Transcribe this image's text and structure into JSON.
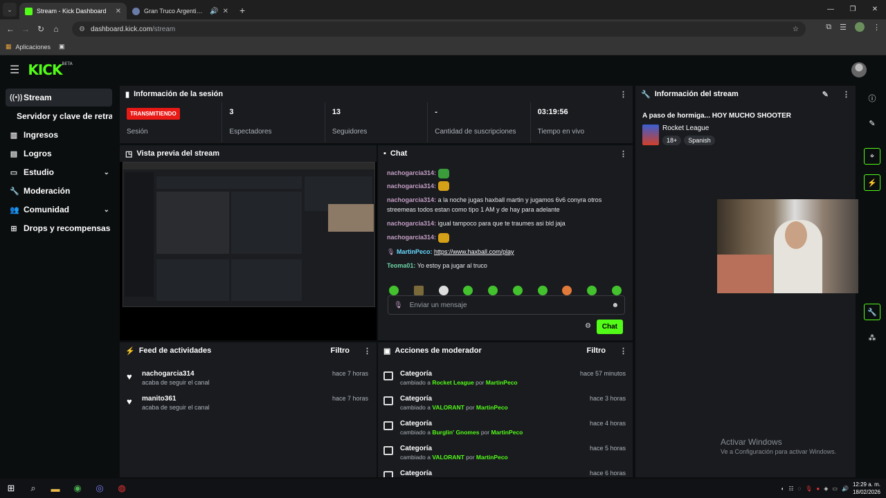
{
  "browser": {
    "tabs": [
      {
        "title": "Stream - Kick Dashboard",
        "active": true
      },
      {
        "title": "Gran Truco Argentino - Jue",
        "active": false
      }
    ],
    "url_host": "dashboard.kick.com",
    "url_path": "/stream",
    "bookmarks": {
      "apps_label": "Aplicaciones"
    }
  },
  "kick": {
    "logo": "KICK",
    "logo_beta": "BETA"
  },
  "sidebar": {
    "items": [
      {
        "label": "Stream",
        "icon": "broadcast-icon"
      },
      {
        "label": "Servidor y clave de retransmisión",
        "icon": ""
      },
      {
        "label": "Ingresos",
        "icon": "chart-icon"
      },
      {
        "label": "Logros",
        "icon": "trophy-icon"
      },
      {
        "label": "Estudio",
        "icon": "studio-icon"
      },
      {
        "label": "Moderación",
        "icon": "wrench-icon"
      },
      {
        "label": "Comunidad",
        "icon": "people-icon"
      },
      {
        "label": "Drops y recompensas",
        "icon": "gift-icon"
      }
    ]
  },
  "session": {
    "title": "Información de la sesión",
    "live_badge": "TRANSMITIENDO",
    "stats": [
      {
        "value": "",
        "label": "Sesión"
      },
      {
        "value": "3",
        "label": "Espectadores"
      },
      {
        "value": "13",
        "label": "Seguidores"
      },
      {
        "value": "-",
        "label": "Cantidad de suscripciones"
      },
      {
        "value": "03:19:56",
        "label": "Tiempo en vivo"
      }
    ]
  },
  "preview": {
    "title": "Vista previa del stream"
  },
  "chat": {
    "title": "Chat",
    "messages": [
      {
        "user": "nachogarcia314:",
        "text": ""
      },
      {
        "user": "nachogarcia314:",
        "text": ""
      },
      {
        "user": "nachogarcia314:",
        "text": "a la noche jugas haxball martin y jugamos 6v6 conyra otros streemeas todos estan como tipo 1 AM y de hay para adelante"
      },
      {
        "user": "nachogarcia314:",
        "text": "igual tampoco para que te traumes asi bld jaja"
      },
      {
        "user": "nachogarcia314:",
        "text": ""
      },
      {
        "user": "MartinPeco:",
        "text": "https://www.haxball.com/play"
      },
      {
        "user": "Teoma01:",
        "text": "Yo estoy pa jugar al truco"
      }
    ],
    "input_placeholder": "Enviar un mensaje",
    "send_label": "Chat"
  },
  "stream_info": {
    "title": "Información del stream",
    "stream_title": "A paso de hormiga... HOY MUCHO SHOOTER",
    "category": "Rocket League",
    "tags": [
      "18+",
      "Spanish"
    ]
  },
  "feed": {
    "title": "Feed de actividades",
    "filter_label": "Filtro",
    "items": [
      {
        "name": "nachogarcia314",
        "desc": "acaba de seguir el canal",
        "time": "hace 7 horas"
      },
      {
        "name": "manito361",
        "desc": "acaba de seguir el canal",
        "time": "hace 7 horas"
      }
    ]
  },
  "mod": {
    "title": "Acciones de moderador",
    "filter_label": "Filtro",
    "items": [
      {
        "name": "Categoría",
        "pre": "cambiado a ",
        "cat": "Rocket League",
        "mid": " por ",
        "by": "MartinPeco",
        "time": "hace 57 minutos"
      },
      {
        "name": "Categoría",
        "pre": "cambiado a ",
        "cat": "VALORANT",
        "mid": " por ",
        "by": "MartinPeco",
        "time": "hace 3 horas"
      },
      {
        "name": "Categoría",
        "pre": "cambiado a ",
        "cat": "Burglin' Gnomes",
        "mid": " por ",
        "by": "MartinPeco",
        "time": "hace 4 horas"
      },
      {
        "name": "Categoría",
        "pre": "cambiado a ",
        "cat": "VALORANT",
        "mid": " por ",
        "by": "MartinPeco",
        "time": "hace 5 horas"
      },
      {
        "name": "Categoría",
        "pre": "",
        "cat": "",
        "mid": "",
        "by": "",
        "time": "hace 6 horas"
      }
    ]
  },
  "windows": {
    "activate_title": "Activar Windows",
    "activate_sub": "Ve a Configuración para activar Windows.",
    "time": "12:29 a. m.",
    "date": "18/02/2026"
  },
  "colors": {
    "accent": "#53fc18",
    "live": "#e91916",
    "panel": "#191b1f",
    "bg": "#0b0e0f"
  }
}
